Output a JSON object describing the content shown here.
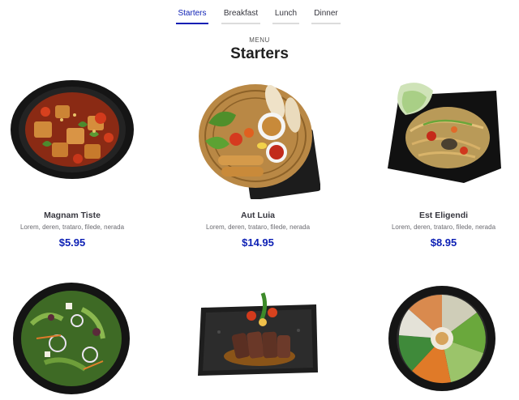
{
  "tabs": [
    {
      "label": "Starters",
      "active": true
    },
    {
      "label": "Breakfast",
      "active": false
    },
    {
      "label": "Lunch",
      "active": false
    },
    {
      "label": "Dinner",
      "active": false
    }
  ],
  "menu": {
    "label": "MENU",
    "title": "Starters"
  },
  "colors": {
    "accent": "#0c1fb4",
    "text": "#37373f"
  },
  "items": [
    {
      "name": "Magnam Tiste",
      "description": "Lorem, deren, trataro, filede, nerada",
      "price": "$5.95"
    },
    {
      "name": "Aut Luia",
      "description": "Lorem, deren, trataro, filede, nerada",
      "price": "$14.95"
    },
    {
      "name": "Est Eligendi",
      "description": "Lorem, deren, trataro, filede, nerada",
      "price": "$8.95"
    },
    {
      "name": "",
      "description": "",
      "price": ""
    },
    {
      "name": "",
      "description": "",
      "price": ""
    },
    {
      "name": "",
      "description": "",
      "price": ""
    }
  ]
}
